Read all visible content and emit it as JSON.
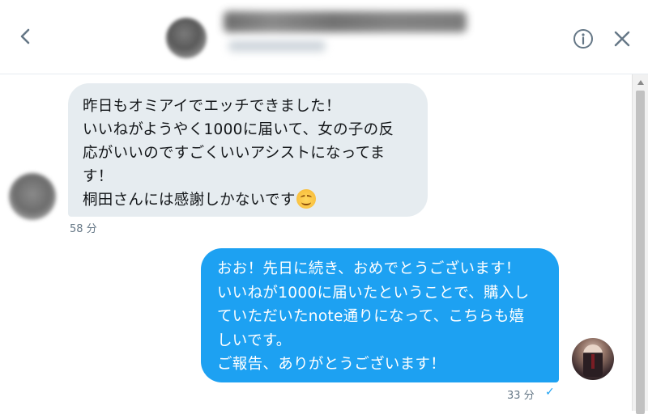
{
  "header": {
    "back_icon": "chevron-left-icon",
    "info_icon": "info-circle-icon",
    "close_icon": "close-icon"
  },
  "messages": [
    {
      "direction": "received",
      "lines": [
        "昨日もオミアイでエッチできました！",
        "いいねがようやく1000に届いて、女の子の反",
        "応がいいのですごくいいアシストになってま",
        "す！",
        "桐田さんには感謝しかないです"
      ],
      "emoji": "smiling-face-emoji",
      "timestamp": "58 分"
    },
    {
      "direction": "sent",
      "lines": [
        "おお！先日に続き、おめでとうございます！",
        "いいねが1000に届いたということで、購入し",
        "ていただいたnote通りになって、こちらも嬉",
        "しいです。",
        "ご報告、ありがとうございます！"
      ],
      "timestamp": "33 分",
      "read_status": "✓"
    }
  ],
  "colors": {
    "sent_bubble": "#1da1f2",
    "received_bubble": "#e6ecf0",
    "timestamp_text": "#657786",
    "header_icon": "#657786"
  }
}
